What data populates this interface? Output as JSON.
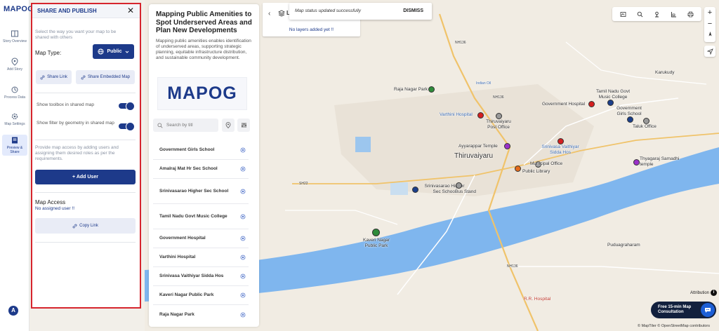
{
  "nav": {
    "logo": "MAPOG",
    "items": [
      {
        "label": "Story Overview",
        "icon": "story-icon"
      },
      {
        "label": "Add Story",
        "icon": "add-story-icon"
      },
      {
        "label": "Process Data",
        "icon": "process-icon"
      },
      {
        "label": "Map Settings",
        "icon": "settings-icon"
      },
      {
        "label": "Preview & Share",
        "icon": "share-icon",
        "active": true
      }
    ],
    "avatar": "A"
  },
  "share_panel": {
    "title": "SHARE AND PUBLISH",
    "close": "✕",
    "intro": "Select the way you want your map to be shared with others",
    "map_type_label": "Map Type:",
    "map_type_value": "Public",
    "share_link": "Share Link",
    "share_embedded": "Share Embedded Map",
    "toggle_toolbox": "Show toolbox in shared map",
    "toggle_filter": "Show filter by geometry in shared map",
    "toggle_toolbox_on": true,
    "toggle_filter_on": true,
    "access_note": "Provide map access by adding users and assigning them desired roles as per the requirements.",
    "add_user": "+ Add User",
    "access_title": "Map Access",
    "access_none": "No assigned user !!",
    "copy_link": "Copy Link"
  },
  "story": {
    "title": "Mapping Public Amenities to Spot Underserved Areas and Plan New Developments",
    "text": "Mapping public amenities enables identification of underserved areas, supporting strategic planning, equitable infrastructure distribution, and sustainable community development.",
    "brand": "MAPOG",
    "search_placeholder": "Search by titl",
    "items": [
      "Government Girls School",
      "Amalraj Mat Hr Sec School",
      "Srinivasarao Higher Sec School",
      "Tamil Nadu Govt Music College",
      "Government Hospital",
      "Varthini Hospital",
      "Srinivasa Vaithiyar Sidda Hos",
      "Kaveri Nagar Public Park",
      "Raja Nagar Park"
    ]
  },
  "map": {
    "layers_empty": "No layers added yet !!",
    "layers_short": "L",
    "toast": "Map status updated successfully",
    "dismiss": "DISMISS",
    "zoom_in": "+",
    "zoom_out": "−",
    "consult_line1": "Free 15-min Map",
    "consult_line2": "Consultation",
    "attribution": "Attribution",
    "copyright": "© MapTiler © OpenStreetMap contributors",
    "labels": {
      "thiruvaiyaru": "Thiruvaiyaru",
      "puduagraharam": "Puduagraharam",
      "karukudy": "Karukudy",
      "nh136_a": "NH136",
      "nh136_b": "NH136",
      "nh136_c": "NH136",
      "sh22": "SH22",
      "indian_oil": "Indian Oil",
      "rr_hospital": "R.R. Hospital"
    },
    "pois": [
      {
        "name": "Raja Nagar Park",
        "color": "#2e8b3a"
      },
      {
        "name": "Government Hospital",
        "color": "#d42020"
      },
      {
        "name": "Tamil Nadu Govt Music College",
        "color": "#1b3f8b"
      },
      {
        "name": "Government Girls School",
        "color": "#1b3f8b"
      },
      {
        "name": "Taluk Office",
        "color": "#999999"
      },
      {
        "name": "Varthini Hospital",
        "color": "#d42020"
      },
      {
        "name": "Thiruvaiyaru Post Office",
        "color": "#999999"
      },
      {
        "name": "Srinivasa Vaithiyar Sidda Hos",
        "color": "#d42020"
      },
      {
        "name": "Ayyarappar Temple",
        "color": "#9b30c9"
      },
      {
        "name": "Thyagaraj Samadhi temple",
        "color": "#9b30c9"
      },
      {
        "name": "Municipal Office",
        "color": "#999999"
      },
      {
        "name": "Public Library",
        "color": "#e56b1a"
      },
      {
        "name": "Srinivasarao Higher Sec School",
        "color": "#1b3f8b"
      },
      {
        "name": "Bus Stand",
        "color": "#999999"
      },
      {
        "name": "Kaveri Nagar Public Park",
        "color": "#2e8b3a"
      }
    ]
  }
}
